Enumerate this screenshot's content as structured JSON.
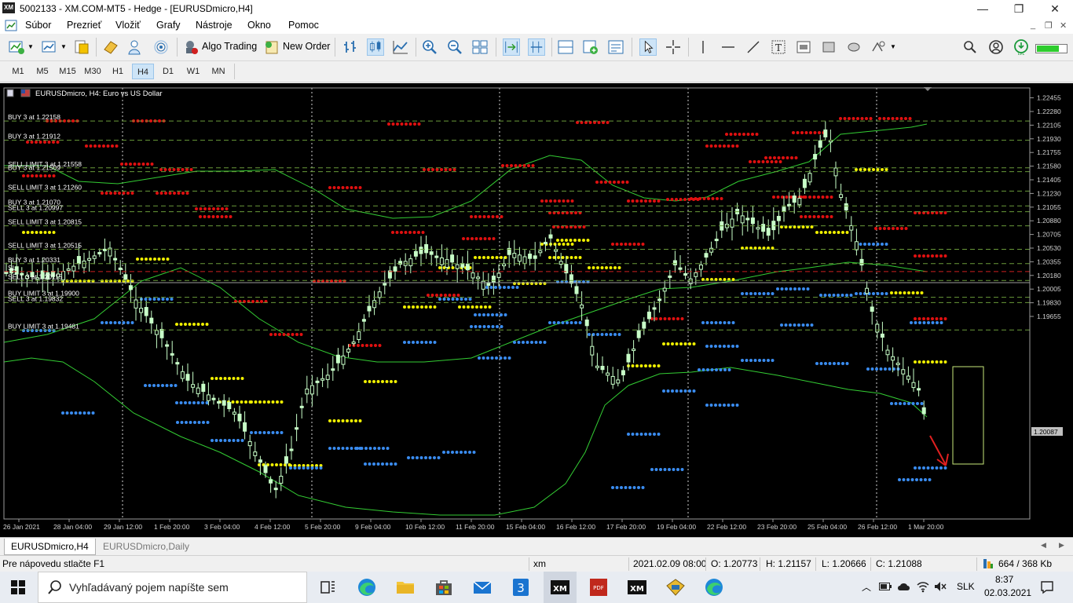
{
  "window": {
    "app_icon_label": "XM",
    "title": "5002133 - XM.COM-MT5 - Hedge - [EURUSDmicro,H4]",
    "minimize": "—",
    "maximize": "❐",
    "close": "✕"
  },
  "menu": {
    "items": [
      "Súbor",
      "Prezrieť",
      "Vložiť",
      "Grafy",
      "Nástroje",
      "Okno",
      "Pomoc"
    ],
    "mdi_minimize": "_",
    "mdi_restore": "❐",
    "mdi_close": "✕"
  },
  "toolbar": {
    "algo_trading": "Algo Trading",
    "new_order": "New Order"
  },
  "timeframes": [
    "M1",
    "M5",
    "M15",
    "M30",
    "H1",
    "H4",
    "D1",
    "W1",
    "MN"
  ],
  "active_timeframe": "H4",
  "chart": {
    "header": "EURUSDmicro, H4:  Euro vs US Dollar",
    "current_price": "1.20087",
    "price_labels": [
      "1.22455",
      "1.22280",
      "1.22105",
      "1.21930",
      "1.21755",
      "1.21580",
      "1.21405",
      "1.21230",
      "1.21055",
      "1.20880",
      "1.20705",
      "1.20530",
      "1.20355",
      "1.20180",
      "1.20005",
      "1.19830",
      "1.19655"
    ],
    "time_labels": [
      "26 Jan 2021",
      "28 Jan 04:00",
      "29 Jan 12:00",
      "1 Feb 20:00",
      "3 Feb 04:00",
      "4 Feb 12:00",
      "5 Feb 20:00",
      "9 Feb 04:00",
      "10 Feb 12:00",
      "11 Feb 20:00",
      "15 Feb 04:00",
      "16 Feb 12:00",
      "17 Feb 20:00",
      "19 Feb 04:00",
      "22 Feb 12:00",
      "23 Feb 20:00",
      "25 Feb 04:00",
      "26 Feb 12:00",
      "1 Mar 20:00"
    ],
    "order_labels": [
      {
        "text": "BUY 3 at 1.22158",
        "price": 1.22158
      },
      {
        "text": "BUY 3 at 1.21912",
        "price": 1.21912
      },
      {
        "text": "SELL LIMIT 3 at 1.21558",
        "price": 1.21558
      },
      {
        "text": "BUY 3 at 1.21509",
        "price": 1.21509
      },
      {
        "text": "SELL LIMIT 3 at 1.21260",
        "price": 1.2126
      },
      {
        "text": "BUY 3 at 1.21070",
        "price": 1.2107
      },
      {
        "text": "SELL 3 at 1.20997",
        "price": 1.20997
      },
      {
        "text": "SELL LIMIT 3 at 1.20815",
        "price": 1.20815
      },
      {
        "text": "SELL LIMIT 3 at 1.20515",
        "price": 1.20515
      },
      {
        "text": "BUY 3 at 1.20331",
        "price": 1.20331
      },
      {
        "text": "SL",
        "price": 1.2023
      },
      {
        "text": "SELL 3 at 1.20115",
        "price": 1.20115
      },
      {
        "text": "BUY LIMIT 3 at 1.19900",
        "price": 1.199
      },
      {
        "text": "SELL 3 at 1.19832",
        "price": 1.19832
      },
      {
        "text": "BUY LIMIT 3 at 1.19481",
        "price": 1.19481
      }
    ]
  },
  "tabs": [
    "EURUSDmicro,H4",
    "EURUSDmicro,Daily"
  ],
  "active_tab": "EURUSDmicro,H4",
  "status": {
    "help": "Pre nápovedu stlačte F1",
    "profile": "xm",
    "datetime": "2021.02.09 08:00",
    "open": "O: 1.20773",
    "high": "H: 1.21157",
    "low": "L: 1.20666",
    "close": "C: 1.21088",
    "traffic": "664 / 368 Kb"
  },
  "taskbar": {
    "search_placeholder": "Vyhľadávaný pojem napíšte sem",
    "language": "SLK",
    "time": "8:37",
    "date": "02.03.2021"
  },
  "colors": {
    "chart_bg": "#000000",
    "candle": "#c8ffc8",
    "bollinger": "#33cc33",
    "dot_red": "#e01010",
    "dot_yellow": "#f0f000",
    "dot_blue": "#3a8cf0",
    "order_line": "#6a9a3a",
    "sl_line": "#cc2020"
  }
}
